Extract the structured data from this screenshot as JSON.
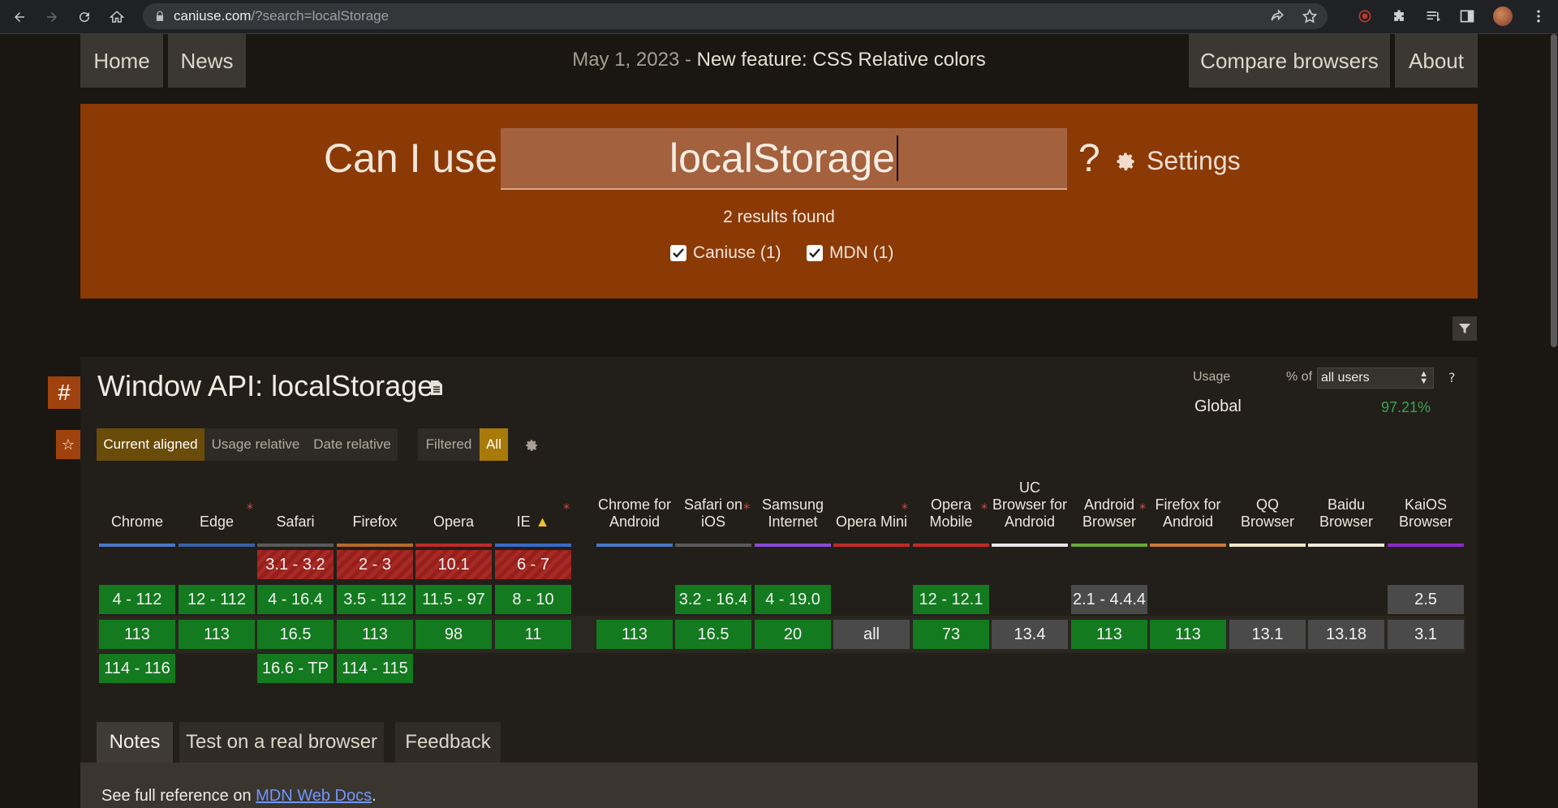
{
  "browser": {
    "url_host": "caniuse.com",
    "url_path": "/?search=localStorage"
  },
  "nav": {
    "home": "Home",
    "news": "News",
    "date": "May 1, 2023",
    "separator": " - ",
    "headline": "New feature: CSS Relative colors",
    "compare": "Compare browsers",
    "about": "About"
  },
  "hero": {
    "title": "Can I use",
    "search_value": "localStorage",
    "question": "?",
    "settings": "Settings",
    "results": "2 results found",
    "sources": [
      {
        "label": "Caniuse (1)",
        "checked": true
      },
      {
        "label": "MDN (1)",
        "checked": true
      }
    ]
  },
  "feature": {
    "hash": "#",
    "star": "☆",
    "title": "Window API: localStorage",
    "usage_label": "Usage",
    "pct_of": "% of",
    "usage_select": "all users",
    "usage_help": "?",
    "global_label": "Global",
    "global_value": "97.21%",
    "views": {
      "current": "Current aligned",
      "usage": "Usage relative",
      "date": "Date relative",
      "filtered": "Filtered",
      "all": "All"
    }
  },
  "browsers": {
    "desktop": [
      {
        "name": "Chrome",
        "bar": "#4a78c8"
      },
      {
        "name": "Edge",
        "bar": "#3a60a8"
      },
      {
        "name": "Safari",
        "bar": "#5a5a5a"
      },
      {
        "name": "Firefox",
        "bar": "#b86a2c"
      },
      {
        "name": "Opera",
        "bar": "#c02a2a"
      },
      {
        "name": "IE",
        "bar": "#3a6ac8"
      }
    ],
    "mobile": [
      {
        "name": "Chrome for Android",
        "bar": "#4a78c8"
      },
      {
        "name": "Safari on iOS",
        "bar": "#5a5a5a"
      },
      {
        "name": "Samsung Internet",
        "bar": "#8a4ad8"
      },
      {
        "name": "Opera Mini",
        "bar": "#c02a2a"
      },
      {
        "name": "Opera Mobile",
        "bar": "#c02a2a"
      },
      {
        "name": "UC Browser for Android",
        "bar": "#e8e8e8"
      },
      {
        "name": "Android Browser",
        "bar": "#6aa83a"
      },
      {
        "name": "Firefox for Android",
        "bar": "#c87a3a"
      },
      {
        "name": "QQ Browser",
        "bar": "#f0e8c8"
      },
      {
        "name": "Baidu Browser",
        "bar": "#f0ecd8"
      },
      {
        "name": "KaiOS Browser",
        "bar": "#8a2ac8"
      }
    ]
  },
  "support": {
    "row1": [
      "3.1 - 3.2",
      "2 - 3",
      "10.1",
      "6 - 7"
    ],
    "row2_desktop": [
      "4 - 112",
      "12 - 112",
      "4 - 16.4",
      "3.5 - 112",
      "11.5 - 97",
      "8 - 10"
    ],
    "row2_mobile": [
      "3.2 - 16.4",
      "4 - 19.0",
      "12 - 12.1",
      "2.1 - 4.4.4",
      "2.5"
    ],
    "current_desktop": [
      "113",
      "113",
      "16.5",
      "113",
      "98",
      "11"
    ],
    "current_mobile": [
      "113",
      "16.5",
      "20",
      "all",
      "73",
      "13.4",
      "113",
      "113",
      "13.1",
      "13.18",
      "3.1"
    ],
    "future": [
      "114 - 116",
      "16.6 - TP",
      "114 - 115"
    ]
  },
  "tabs": {
    "notes": "Notes",
    "test": "Test on a real browser",
    "feedback": "Feedback"
  },
  "reference": {
    "prefix": "See full reference on ",
    "link": "MDN Web Docs",
    "suffix": "."
  },
  "colors": {
    "supported": "#137a1f",
    "unsupported": "#a82a24",
    "unknown": "#4a4a4a",
    "hero": "#8b3a06",
    "accent": "#a0420e"
  }
}
